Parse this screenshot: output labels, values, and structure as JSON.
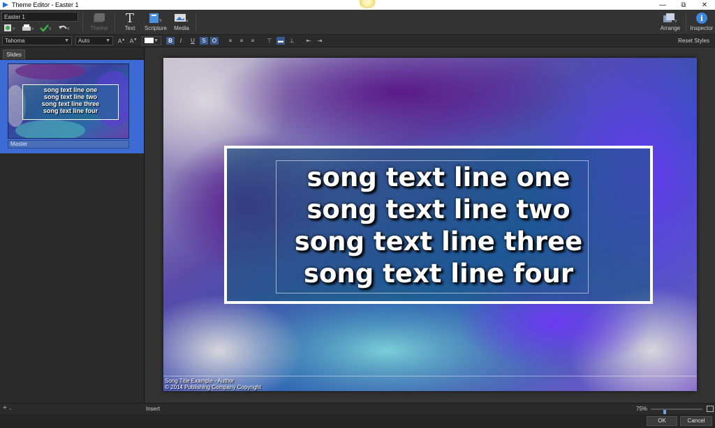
{
  "window": {
    "title": "Theme Editor - Easter 1",
    "controls": [
      "minimize",
      "restore",
      "close"
    ]
  },
  "ribbon": {
    "name_value": "Easter 1",
    "buttons": {
      "theme": "Theme",
      "text": "Text",
      "scripture": "Scripture",
      "media": "Media",
      "arrange": "Arrange",
      "inspector": "Inspector"
    }
  },
  "formatbar": {
    "font": "Tahoma",
    "size": "Auto",
    "bold": "B",
    "italic": "I",
    "underline": "U",
    "strike": "S",
    "outline": "O",
    "reset_styles": "Reset Styles"
  },
  "sidebar": {
    "tab": "Slides",
    "slide_title": "Master"
  },
  "slide": {
    "lines": [
      "song text line one",
      "song text line two",
      "song text line three",
      "song text line four"
    ],
    "footer_title": "Song Title Example - Author",
    "footer_copyright": "© 2014 Publishing Company Copyright"
  },
  "statusbar": {
    "add": "+",
    "insert": "Insert",
    "zoom": "75%",
    "zoom_fraction": 0.25
  },
  "dialog": {
    "ok": "OK",
    "cancel": "Cancel"
  },
  "colors": {
    "accent": "#3d6bd6",
    "background": "#2d2d2d",
    "text_box_border": "#ffffff"
  }
}
